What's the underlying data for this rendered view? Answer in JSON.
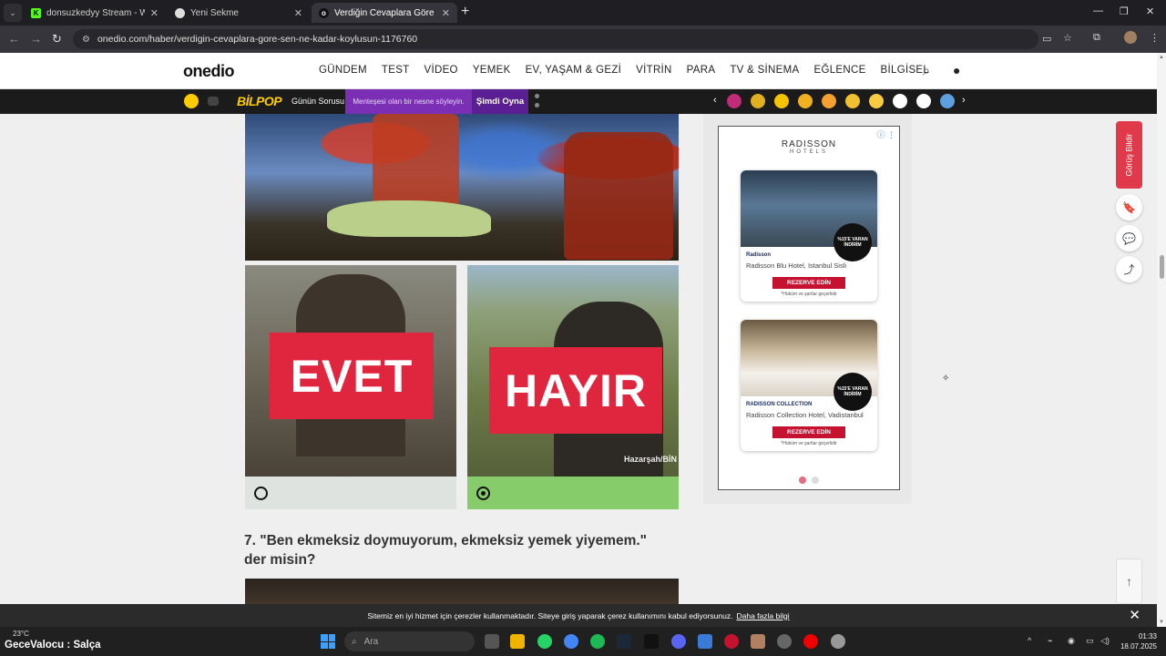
{
  "browser": {
    "tabs": [
      {
        "title": "donsuzkedyy Stream - Watch L",
        "favicon": "kick-icon",
        "active": false
      },
      {
        "title": "Yeni Sekme",
        "favicon": "chrome-icon",
        "active": false
      },
      {
        "title": "Verdiğin Cevaplara Göre Sen N",
        "favicon": "onedio-icon",
        "active": true
      }
    ],
    "url": "onedio.com/haber/verdigin-cevaplara-gore-sen-ne-kadar-koylusun-1176760"
  },
  "site": {
    "logo": "onedio",
    "menu": [
      "GÜNDEM",
      "TEST",
      "VİDEO",
      "YEMEK",
      "EV, YAŞAM & GEZİ",
      "VİTRİN",
      "PARA",
      "TV & SİNEMA",
      "EĞLENCE",
      "BİLGİSEL"
    ]
  },
  "bilpop": {
    "logo": "BİLPOP",
    "daily_label": "Günün Sorusu",
    "question": "Menteşesi olan bir nesne söyleyin.",
    "play_label": "Şimdi Oyna"
  },
  "article": {
    "options": [
      {
        "label": "EVET",
        "selected": false
      },
      {
        "label": "HAYIR",
        "selected": true,
        "watermark": "Hazarşah/BİN"
      }
    ],
    "next_question": "7. \"Ben ekmeksiz doymuyorum, ekmeksiz yemek yiyemem.\" der misin?"
  },
  "ad": {
    "brand": "RADISSON",
    "brand_sub": "HOTELS",
    "cards": [
      {
        "hotel": "Radisson Blu Hotel, Istanbul Sisli",
        "badge": "%15'E VARAN İNDİRİM",
        "cta": "REZERVE EDİN",
        "terms": "*Hüküm ve şartlar geçerlidir",
        "logo": "Radisson"
      },
      {
        "hotel": "Radisson Collection Hotel, Vadistanbul",
        "badge": "%15'E VARAN İNDİRİM",
        "cta": "REZERVE EDİN",
        "terms": "*Hüküm ve şartlar geçerlidir",
        "logo": "RADISSON COLLECTION"
      }
    ],
    "active_dot": 0
  },
  "side": {
    "feedback": "Görüş Bildir"
  },
  "cookie": {
    "text": "Sitemiz en iyi hizmet için çerezler kullanmaktadır. Siteye giriş yaparak çerez kullanımını kabul ediyorsunuz.",
    "link": "Daha fazla bilgi"
  },
  "taskbar": {
    "weather": "23°C",
    "now_playing_artist": "GeceValocu",
    "now_playing_sep": " : ",
    "now_playing_title": "Salça",
    "search_placeholder": "Ara",
    "time": "01:33",
    "date": "18.07.2025"
  }
}
